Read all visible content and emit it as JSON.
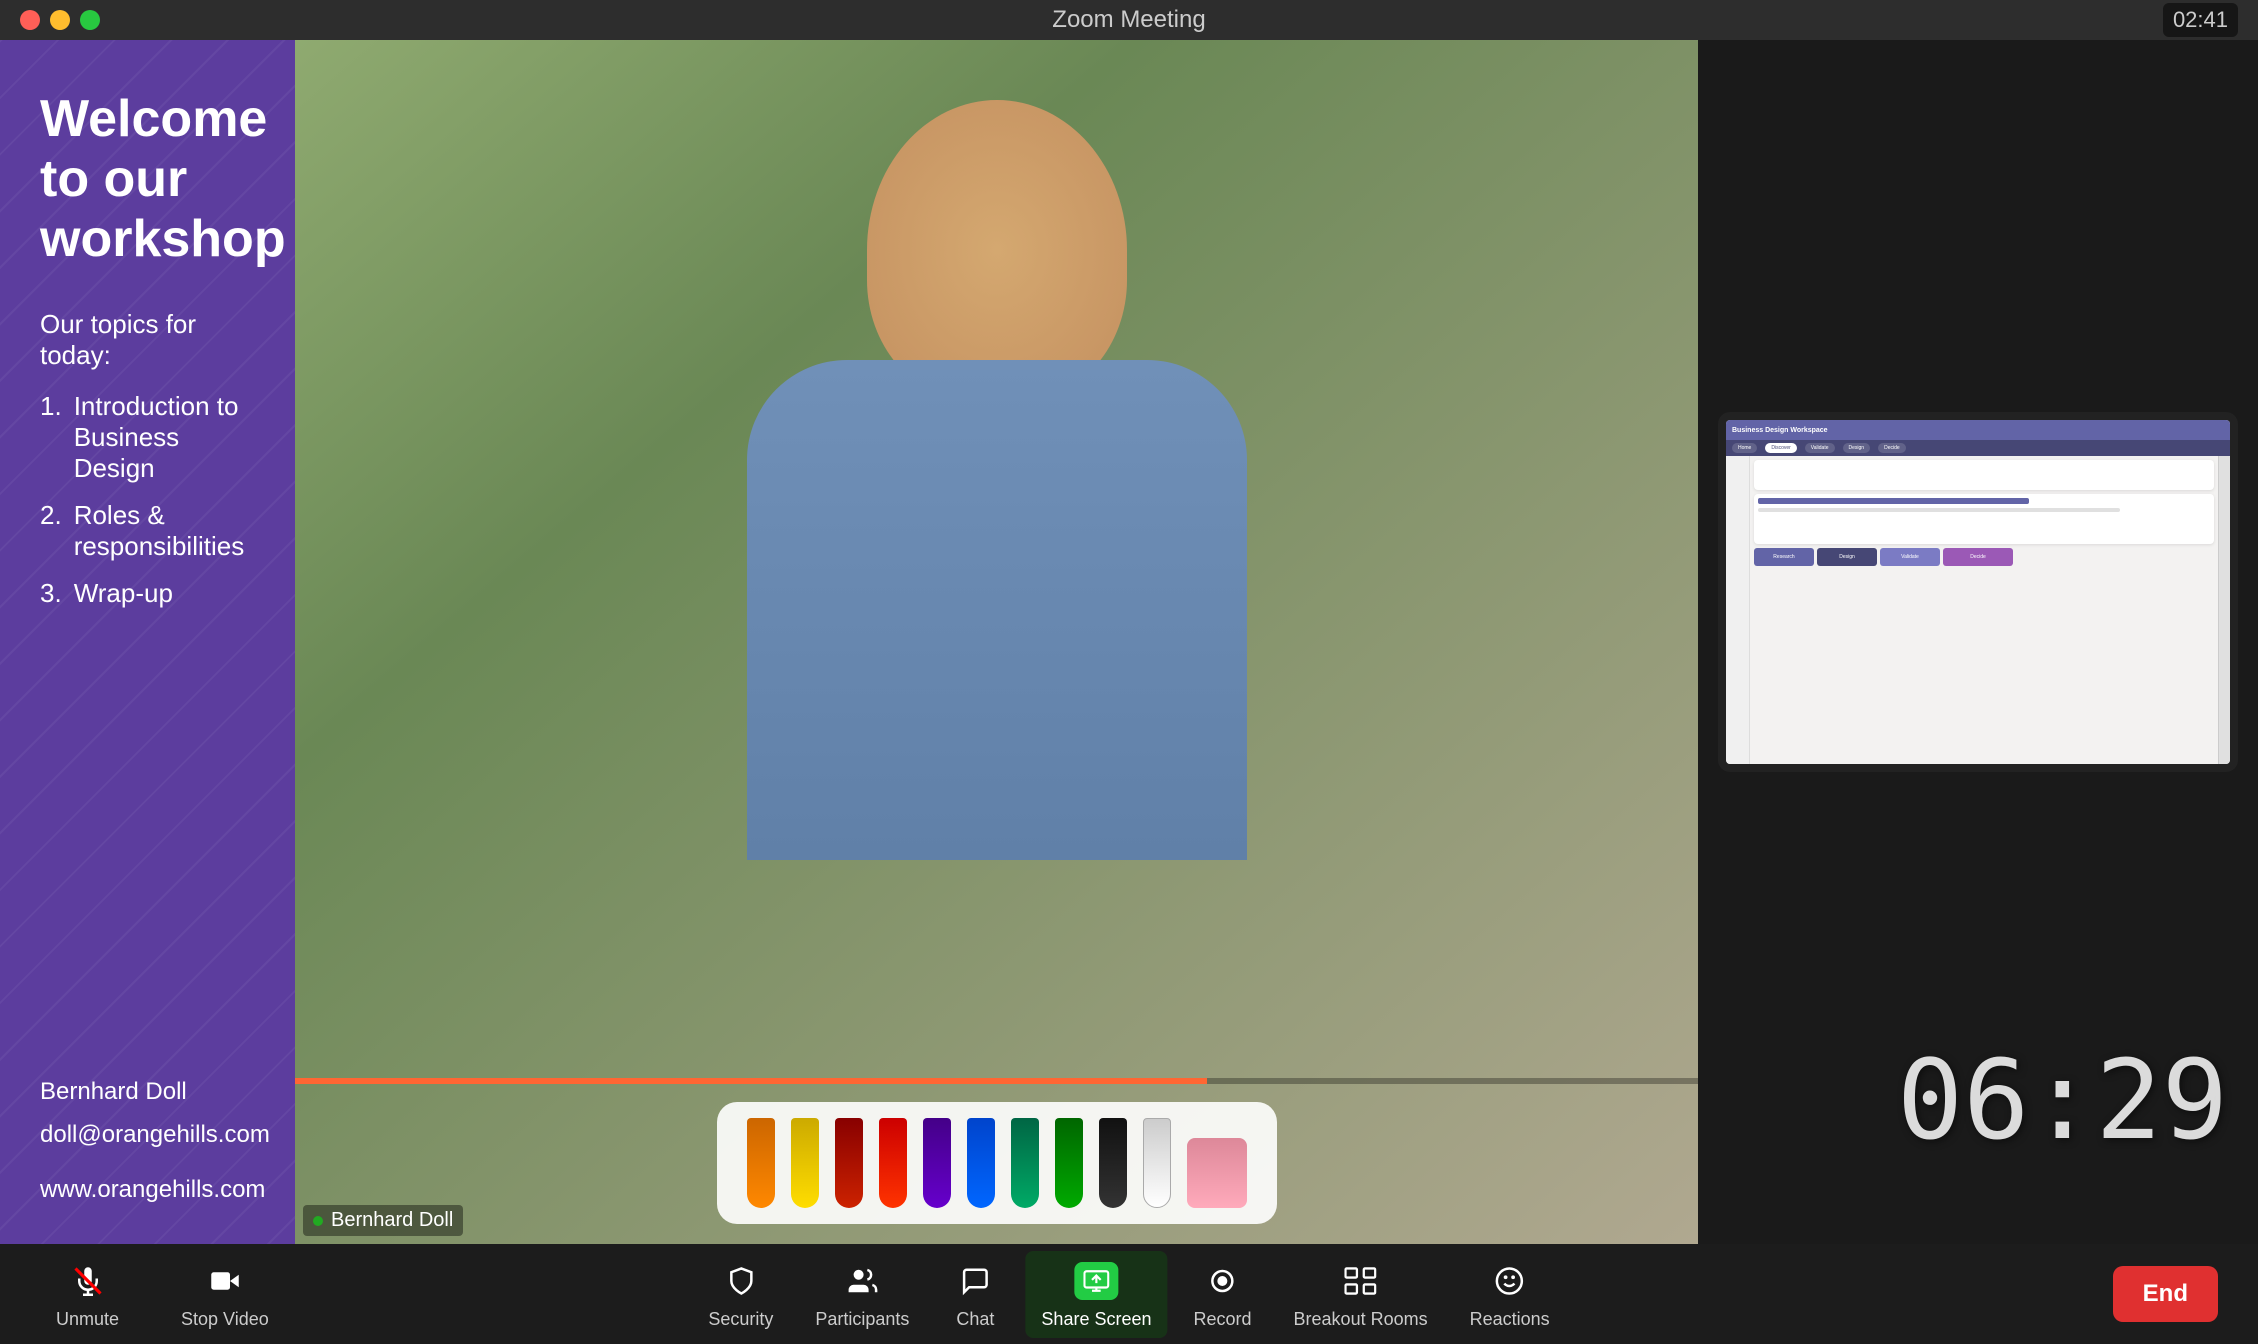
{
  "window": {
    "title": "Zoom Meeting",
    "time_badge": "02:41"
  },
  "slide": {
    "welcome_text": "Welcome to our workshop",
    "topics_intro": "Our topics for today:",
    "topics": [
      {
        "number": "1.",
        "text": "Introduction to Business Design"
      },
      {
        "number": "2.",
        "text": "Roles & responsibilities"
      },
      {
        "number": "3.",
        "text": "Wrap-up"
      }
    ],
    "presenter_name": "Bernhard Doll",
    "presenter_email": "doll@orangehills.com",
    "presenter_website": "www.orangehills.com"
  },
  "timer": {
    "value": "06:29"
  },
  "name_label": "Bernhard Doll",
  "monitor": {
    "app_title": "Business Design Workspace",
    "nav_items": [
      "Home",
      "Discover",
      "Validate",
      "Design",
      "Decide"
    ]
  },
  "toolbar": {
    "unmute_label": "Unmute",
    "stop_video_label": "Stop Video",
    "security_label": "Security",
    "participants_label": "Participants",
    "chat_label": "Chat",
    "share_screen_label": "Share Screen",
    "record_label": "Record",
    "breakout_rooms_label": "Breakout Rooms",
    "reactions_label": "Reactions",
    "end_label": "End"
  }
}
